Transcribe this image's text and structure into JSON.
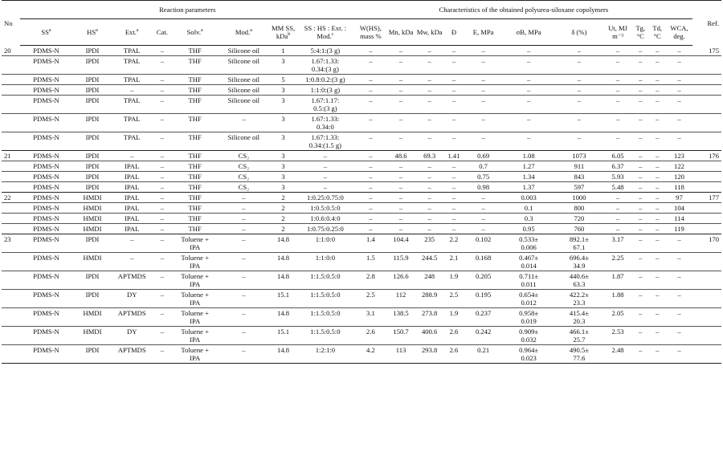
{
  "header": {
    "reaction_parameters": "Reaction parameters",
    "characteristics": "Characteristics of the obtained polyurea-siloxane copolymers",
    "no": "No",
    "ref": "Ref.",
    "cols": {
      "ss": "SS",
      "hs": "HS",
      "ext": "Ext.",
      "cat": "Cat.",
      "solv": "Solv.",
      "mod": "Mod.",
      "mm_ss": "MM SS, kDa",
      "ratio": "SS : HS : Ext. : Mod.",
      "w_hs": "W(HS), mass %",
      "mn": "Mn, kDa",
      "mw": "Mw, kDa",
      "d": "Đ",
      "e": "E, MPa",
      "sigma": "σB, MPa",
      "delta": "δ (%)",
      "ut": "Ut, MJ m⁻³",
      "tg": "Tg, °C",
      "td": "Td, °C",
      "wca": "WCA, deg."
    },
    "footnote_marks": {
      "a": "a",
      "b": "b",
      "c": "c"
    }
  },
  "rows": [
    {
      "no": "20",
      "ref": "175",
      "ss": "PDMS-N",
      "hs": "IPDI",
      "ext": "TPAL",
      "cat": "–",
      "solv": "THF",
      "mod": "Silicone oil",
      "mm": "1",
      "ratio": "5:4:1:(3 g)",
      "w": "–",
      "mn": "–",
      "mw": "–",
      "d": "–",
      "e": "–",
      "s": "–",
      "del": "–",
      "ut": "–",
      "tg": "–",
      "td": "–",
      "wca": "–",
      "last": false
    },
    {
      "no": "",
      "ref": "",
      "ss": "PDMS-N",
      "hs": "IPDI",
      "ext": "TPAL",
      "cat": "–",
      "solv": "THF",
      "mod": "Silicone oil",
      "mm": "3",
      "ratio": "1.67:1.33:\n0.34:(3 g)",
      "w": "–",
      "mn": "–",
      "mw": "–",
      "d": "–",
      "e": "–",
      "s": "–",
      "del": "–",
      "ut": "–",
      "tg": "–",
      "td": "–",
      "wca": "–",
      "last": false
    },
    {
      "no": "",
      "ref": "",
      "ss": "PDMS-N",
      "hs": "IPDI",
      "ext": "TPAL",
      "cat": "–",
      "solv": "THF",
      "mod": "Silicone oil",
      "mm": "5",
      "ratio": "1:0.8:0.2:(3 g)",
      "w": "–",
      "mn": "–",
      "mw": "–",
      "d": "–",
      "e": "–",
      "s": "–",
      "del": "–",
      "ut": "–",
      "tg": "–",
      "td": "–",
      "wca": "–",
      "last": false
    },
    {
      "no": "",
      "ref": "",
      "ss": "PDMS-N",
      "hs": "IPDI",
      "ext": "–",
      "cat": "–",
      "solv": "THF",
      "mod": "Silicone oil",
      "mm": "3",
      "ratio": "1:1:0:(3 g)",
      "w": "–",
      "mn": "–",
      "mw": "–",
      "d": "–",
      "e": "–",
      "s": "–",
      "del": "–",
      "ut": "–",
      "tg": "–",
      "td": "–",
      "wca": "–",
      "last": false
    },
    {
      "no": "",
      "ref": "",
      "ss": "PDMS-N",
      "hs": "IPDI",
      "ext": "TPAL",
      "cat": "–",
      "solv": "THF",
      "mod": "Silicone oil",
      "mm": "3",
      "ratio": "1.67:1.17:\n0.5:(3 g)",
      "w": "–",
      "mn": "–",
      "mw": "–",
      "d": "–",
      "e": "–",
      "s": "–",
      "del": "–",
      "ut": "–",
      "tg": "–",
      "td": "–",
      "wca": "–",
      "last": false
    },
    {
      "no": "",
      "ref": "",
      "ss": "PDMS-N",
      "hs": "IPDI",
      "ext": "TPAL",
      "cat": "–",
      "solv": "THF",
      "mod": "–",
      "mm": "3",
      "ratio": "1.67:1.33:\n0.34:0",
      "w": "–",
      "mn": "–",
      "mw": "–",
      "d": "–",
      "e": "–",
      "s": "–",
      "del": "–",
      "ut": "–",
      "tg": "–",
      "td": "–",
      "wca": "–",
      "last": false
    },
    {
      "no": "",
      "ref": "",
      "ss": "PDMS-N",
      "hs": "IPDI",
      "ext": "TPAL",
      "cat": "–",
      "solv": "THF",
      "mod": "Silicone oil",
      "mm": "3",
      "ratio": "1.67:1.33:\n0.34:(1.5 g)",
      "w": "–",
      "mn": "–",
      "mw": "–",
      "d": "–",
      "e": "–",
      "s": "–",
      "del": "–",
      "ut": "–",
      "tg": "–",
      "td": "–",
      "wca": "–",
      "last": true
    },
    {
      "no": "21",
      "ref": "176",
      "ss": "PDMS-N",
      "hs": "IPDI",
      "ext": "–",
      "cat": "–",
      "solv": "THF",
      "mod": "CS₂",
      "mm": "3",
      "ratio": "–",
      "w": "–",
      "mn": "48.6",
      "mw": "69.3",
      "d": "1.41",
      "e": "0.69",
      "s": "1.08",
      "del": "1073",
      "ut": "6.05",
      "tg": "–",
      "td": "–",
      "wca": "123",
      "last": false
    },
    {
      "no": "",
      "ref": "",
      "ss": "PDMS-N",
      "hs": "IPDI",
      "ext": "IPAL",
      "cat": "–",
      "solv": "THF",
      "mod": "CS₂",
      "mm": "3",
      "ratio": "–",
      "w": "–",
      "mn": "–",
      "mw": "–",
      "d": "–",
      "e": "0.7",
      "s": "1.27",
      "del": "911",
      "ut": "6.37",
      "tg": "–",
      "td": "–",
      "wca": "122",
      "last": false
    },
    {
      "no": "",
      "ref": "",
      "ss": "PDMS-N",
      "hs": "IPDI",
      "ext": "IPAL",
      "cat": "–",
      "solv": "THF",
      "mod": "CS₂",
      "mm": "3",
      "ratio": "–",
      "w": "–",
      "mn": "–",
      "mw": "–",
      "d": "–",
      "e": "0.75",
      "s": "1.34",
      "del": "843",
      "ut": "5.93",
      "tg": "–",
      "td": "–",
      "wca": "120",
      "last": false
    },
    {
      "no": "",
      "ref": "",
      "ss": "PDMS-N",
      "hs": "IPDI",
      "ext": "IPAL",
      "cat": "–",
      "solv": "THF",
      "mod": "CS₂",
      "mm": "3",
      "ratio": "–",
      "w": "–",
      "mn": "–",
      "mw": "–",
      "d": "–",
      "e": "0.98",
      "s": "1.37",
      "del": "597",
      "ut": "5.48",
      "tg": "–",
      "td": "–",
      "wca": "118",
      "last": true
    },
    {
      "no": "22",
      "ref": "177",
      "ss": "PDMS-N",
      "hs": "HMDI",
      "ext": "IPAL",
      "cat": "–",
      "solv": "THF",
      "mod": "–",
      "mm": "2",
      "ratio": "1:0.25:0.75:0",
      "w": "–",
      "mn": "–",
      "mw": "–",
      "d": "–",
      "e": "–",
      "s": "0.003",
      "del": "1000",
      "ut": "–",
      "tg": "–",
      "td": "–",
      "wca": "97",
      "last": false
    },
    {
      "no": "",
      "ref": "",
      "ss": "PDMS-N",
      "hs": "HMDI",
      "ext": "IPAL",
      "cat": "–",
      "solv": "THF",
      "mod": "–",
      "mm": "2",
      "ratio": "1:0.5:0.5:0",
      "w": "–",
      "mn": "–",
      "mw": "–",
      "d": "–",
      "e": "–",
      "s": "0.1",
      "del": "800",
      "ut": "–",
      "tg": "–",
      "td": "–",
      "wca": "104",
      "last": false
    },
    {
      "no": "",
      "ref": "",
      "ss": "PDMS-N",
      "hs": "HMDI",
      "ext": "IPAL",
      "cat": "–",
      "solv": "THF",
      "mod": "–",
      "mm": "2",
      "ratio": "1:0.6:0.4:0",
      "w": "–",
      "mn": "–",
      "mw": "–",
      "d": "–",
      "e": "–",
      "s": "0.3",
      "del": "720",
      "ut": "–",
      "tg": "–",
      "td": "–",
      "wca": "114",
      "last": false
    },
    {
      "no": "",
      "ref": "",
      "ss": "PDMS-N",
      "hs": "HMDI",
      "ext": "IPAL",
      "cat": "–",
      "solv": "THF",
      "mod": "–",
      "mm": "2",
      "ratio": "1:0.75:0.25:0",
      "w": "–",
      "mn": "–",
      "mw": "–",
      "d": "–",
      "e": "–",
      "s": "0.95",
      "del": "760",
      "ut": "–",
      "tg": "–",
      "td": "–",
      "wca": "119",
      "last": true
    },
    {
      "no": "23",
      "ref": "170",
      "ss": "PDMS-N",
      "hs": "IPDI",
      "ext": "–",
      "cat": "–",
      "solv": "Toluene +\nIPA",
      "mod": "–",
      "mm": "14.8",
      "ratio": "1:1:0:0",
      "w": "1.4",
      "mn": "104.4",
      "mw": "235",
      "d": "2.2",
      "e": "0.102",
      "s": "0.533±\n0.006",
      "del": "892.1±\n67.1",
      "ut": "3.17",
      "tg": "–",
      "td": "–",
      "wca": "–",
      "last": false
    },
    {
      "no": "",
      "ref": "",
      "ss": "PDMS-N",
      "hs": "HMDI",
      "ext": "–",
      "cat": "–",
      "solv": "Toluene +\nIPA",
      "mod": "–",
      "mm": "14.8",
      "ratio": "1:1:0:0",
      "w": "1.5",
      "mn": "115.9",
      "mw": "244.5",
      "d": "2.1",
      "e": "0.168",
      "s": "0.467±\n0.014",
      "del": "696.4±\n34.9",
      "ut": "2.25",
      "tg": "–",
      "td": "–",
      "wca": "–",
      "last": false
    },
    {
      "no": "",
      "ref": "",
      "ss": "PDMS-N",
      "hs": "IPDI",
      "ext": "APTMDS",
      "cat": "–",
      "solv": "Toluene +\nIPA",
      "mod": "–",
      "mm": "14.8",
      "ratio": "1:1.5:0.5:0",
      "w": "2.8",
      "mn": "126.6",
      "mw": "248",
      "d": "1.9",
      "e": "0.205",
      "s": "0.711±\n0.011",
      "del": "440.6±\n63.3",
      "ut": "1.87",
      "tg": "–",
      "td": "–",
      "wca": "–",
      "last": false
    },
    {
      "no": "",
      "ref": "",
      "ss": "PDMS-N",
      "hs": "IPDI",
      "ext": "DY",
      "cat": "–",
      "solv": "Toluene +\nIPA",
      "mod": "–",
      "mm": "15.1",
      "ratio": "1:1.5:0.5:0",
      "w": "2.5",
      "mn": "112",
      "mw": "288.9",
      "d": "2.5",
      "e": "0.195",
      "s": "0.654±\n0.012",
      "del": "422.2±\n23.3",
      "ut": "1.88",
      "tg": "–",
      "td": "–",
      "wca": "–",
      "last": false
    },
    {
      "no": "",
      "ref": "",
      "ss": "PDMS-N",
      "hs": "HMDI",
      "ext": "APTMDS",
      "cat": "–",
      "solv": "Toluene +\nIPA",
      "mod": "–",
      "mm": "14.8",
      "ratio": "1:1.5:0.5:0",
      "w": "3.1",
      "mn": "138.5",
      "mw": "273.8",
      "d": "1.9",
      "e": "0.237",
      "s": "0.958±\n0.019",
      "del": "415.4±\n20.3",
      "ut": "2.05",
      "tg": "–",
      "td": "–",
      "wca": "–",
      "last": false
    },
    {
      "no": "",
      "ref": "",
      "ss": "PDMS-N",
      "hs": "HMDI",
      "ext": "DY",
      "cat": "–",
      "solv": "Toluene +\nIPA",
      "mod": "–",
      "mm": "15.1",
      "ratio": "1:1.5:0.5:0",
      "w": "2.6",
      "mn": "150.7",
      "mw": "400.6",
      "d": "2.6",
      "e": "0.242",
      "s": "0.909±\n0.032",
      "del": "466.1±\n25.7",
      "ut": "2.53",
      "tg": "–",
      "td": "–",
      "wca": "–",
      "last": false
    },
    {
      "no": "",
      "ref": "",
      "ss": "PDMS-N",
      "hs": "IPDI",
      "ext": "APTMDS",
      "cat": "–",
      "solv": "Toluene +\nIPA",
      "mod": "–",
      "mm": "14.8",
      "ratio": "1:2:1:0",
      "w": "4.2",
      "mn": "113",
      "mw": "293.8",
      "d": "2.6",
      "e": "0.21",
      "s": "0.964±\n0.023",
      "del": "490.5±\n77.6",
      "ut": "2.48",
      "tg": "–",
      "td": "–",
      "wca": "–",
      "last": true
    }
  ]
}
